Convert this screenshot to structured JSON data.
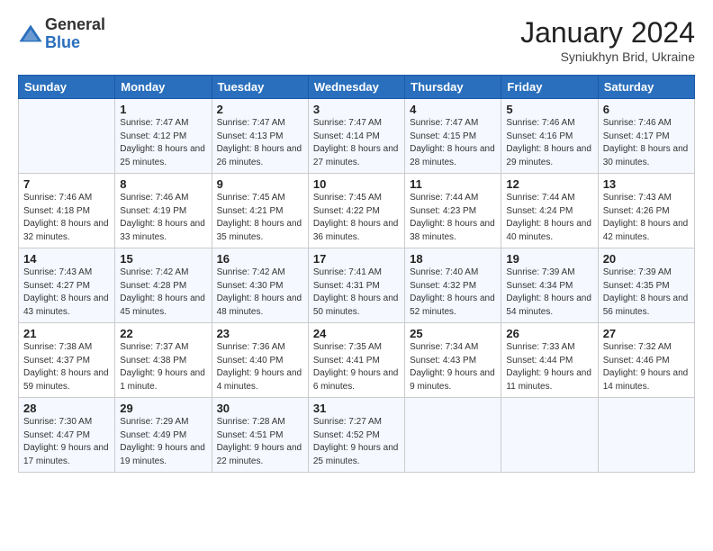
{
  "header": {
    "logo": {
      "general": "General",
      "blue": "Blue"
    },
    "title": "January 2024",
    "subtitle": "Syniukhyn Brid, Ukraine"
  },
  "days_of_week": [
    "Sunday",
    "Monday",
    "Tuesday",
    "Wednesday",
    "Thursday",
    "Friday",
    "Saturday"
  ],
  "weeks": [
    [
      {
        "day": "",
        "sunrise": "",
        "sunset": "",
        "daylight": ""
      },
      {
        "day": "1",
        "sunrise": "Sunrise: 7:47 AM",
        "sunset": "Sunset: 4:12 PM",
        "daylight": "Daylight: 8 hours and 25 minutes."
      },
      {
        "day": "2",
        "sunrise": "Sunrise: 7:47 AM",
        "sunset": "Sunset: 4:13 PM",
        "daylight": "Daylight: 8 hours and 26 minutes."
      },
      {
        "day": "3",
        "sunrise": "Sunrise: 7:47 AM",
        "sunset": "Sunset: 4:14 PM",
        "daylight": "Daylight: 8 hours and 27 minutes."
      },
      {
        "day": "4",
        "sunrise": "Sunrise: 7:47 AM",
        "sunset": "Sunset: 4:15 PM",
        "daylight": "Daylight: 8 hours and 28 minutes."
      },
      {
        "day": "5",
        "sunrise": "Sunrise: 7:46 AM",
        "sunset": "Sunset: 4:16 PM",
        "daylight": "Daylight: 8 hours and 29 minutes."
      },
      {
        "day": "6",
        "sunrise": "Sunrise: 7:46 AM",
        "sunset": "Sunset: 4:17 PM",
        "daylight": "Daylight: 8 hours and 30 minutes."
      }
    ],
    [
      {
        "day": "7",
        "sunrise": "Sunrise: 7:46 AM",
        "sunset": "Sunset: 4:18 PM",
        "daylight": "Daylight: 8 hours and 32 minutes."
      },
      {
        "day": "8",
        "sunrise": "Sunrise: 7:46 AM",
        "sunset": "Sunset: 4:19 PM",
        "daylight": "Daylight: 8 hours and 33 minutes."
      },
      {
        "day": "9",
        "sunrise": "Sunrise: 7:45 AM",
        "sunset": "Sunset: 4:21 PM",
        "daylight": "Daylight: 8 hours and 35 minutes."
      },
      {
        "day": "10",
        "sunrise": "Sunrise: 7:45 AM",
        "sunset": "Sunset: 4:22 PM",
        "daylight": "Daylight: 8 hours and 36 minutes."
      },
      {
        "day": "11",
        "sunrise": "Sunrise: 7:44 AM",
        "sunset": "Sunset: 4:23 PM",
        "daylight": "Daylight: 8 hours and 38 minutes."
      },
      {
        "day": "12",
        "sunrise": "Sunrise: 7:44 AM",
        "sunset": "Sunset: 4:24 PM",
        "daylight": "Daylight: 8 hours and 40 minutes."
      },
      {
        "day": "13",
        "sunrise": "Sunrise: 7:43 AM",
        "sunset": "Sunset: 4:26 PM",
        "daylight": "Daylight: 8 hours and 42 minutes."
      }
    ],
    [
      {
        "day": "14",
        "sunrise": "Sunrise: 7:43 AM",
        "sunset": "Sunset: 4:27 PM",
        "daylight": "Daylight: 8 hours and 43 minutes."
      },
      {
        "day": "15",
        "sunrise": "Sunrise: 7:42 AM",
        "sunset": "Sunset: 4:28 PM",
        "daylight": "Daylight: 8 hours and 45 minutes."
      },
      {
        "day": "16",
        "sunrise": "Sunrise: 7:42 AM",
        "sunset": "Sunset: 4:30 PM",
        "daylight": "Daylight: 8 hours and 48 minutes."
      },
      {
        "day": "17",
        "sunrise": "Sunrise: 7:41 AM",
        "sunset": "Sunset: 4:31 PM",
        "daylight": "Daylight: 8 hours and 50 minutes."
      },
      {
        "day": "18",
        "sunrise": "Sunrise: 7:40 AM",
        "sunset": "Sunset: 4:32 PM",
        "daylight": "Daylight: 8 hours and 52 minutes."
      },
      {
        "day": "19",
        "sunrise": "Sunrise: 7:39 AM",
        "sunset": "Sunset: 4:34 PM",
        "daylight": "Daylight: 8 hours and 54 minutes."
      },
      {
        "day": "20",
        "sunrise": "Sunrise: 7:39 AM",
        "sunset": "Sunset: 4:35 PM",
        "daylight": "Daylight: 8 hours and 56 minutes."
      }
    ],
    [
      {
        "day": "21",
        "sunrise": "Sunrise: 7:38 AM",
        "sunset": "Sunset: 4:37 PM",
        "daylight": "Daylight: 8 hours and 59 minutes."
      },
      {
        "day": "22",
        "sunrise": "Sunrise: 7:37 AM",
        "sunset": "Sunset: 4:38 PM",
        "daylight": "Daylight: 9 hours and 1 minute."
      },
      {
        "day": "23",
        "sunrise": "Sunrise: 7:36 AM",
        "sunset": "Sunset: 4:40 PM",
        "daylight": "Daylight: 9 hours and 4 minutes."
      },
      {
        "day": "24",
        "sunrise": "Sunrise: 7:35 AM",
        "sunset": "Sunset: 4:41 PM",
        "daylight": "Daylight: 9 hours and 6 minutes."
      },
      {
        "day": "25",
        "sunrise": "Sunrise: 7:34 AM",
        "sunset": "Sunset: 4:43 PM",
        "daylight": "Daylight: 9 hours and 9 minutes."
      },
      {
        "day": "26",
        "sunrise": "Sunrise: 7:33 AM",
        "sunset": "Sunset: 4:44 PM",
        "daylight": "Daylight: 9 hours and 11 minutes."
      },
      {
        "day": "27",
        "sunrise": "Sunrise: 7:32 AM",
        "sunset": "Sunset: 4:46 PM",
        "daylight": "Daylight: 9 hours and 14 minutes."
      }
    ],
    [
      {
        "day": "28",
        "sunrise": "Sunrise: 7:30 AM",
        "sunset": "Sunset: 4:47 PM",
        "daylight": "Daylight: 9 hours and 17 minutes."
      },
      {
        "day": "29",
        "sunrise": "Sunrise: 7:29 AM",
        "sunset": "Sunset: 4:49 PM",
        "daylight": "Daylight: 9 hours and 19 minutes."
      },
      {
        "day": "30",
        "sunrise": "Sunrise: 7:28 AM",
        "sunset": "Sunset: 4:51 PM",
        "daylight": "Daylight: 9 hours and 22 minutes."
      },
      {
        "day": "31",
        "sunrise": "Sunrise: 7:27 AM",
        "sunset": "Sunset: 4:52 PM",
        "daylight": "Daylight: 9 hours and 25 minutes."
      },
      {
        "day": "",
        "sunrise": "",
        "sunset": "",
        "daylight": ""
      },
      {
        "day": "",
        "sunrise": "",
        "sunset": "",
        "daylight": ""
      },
      {
        "day": "",
        "sunrise": "",
        "sunset": "",
        "daylight": ""
      }
    ]
  ]
}
